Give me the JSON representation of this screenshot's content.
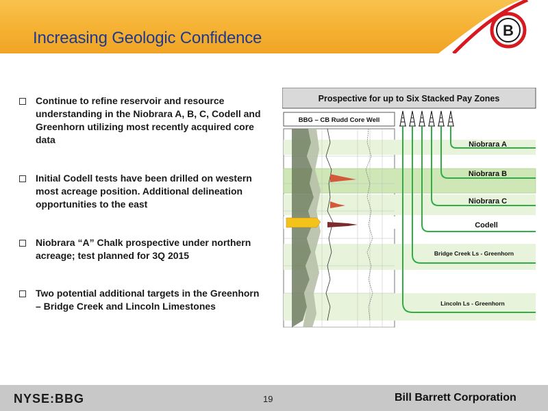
{
  "header": {
    "title": "Increasing Geologic Confidence",
    "logo_letter": "B"
  },
  "bullets": [
    "Continue to refine reservoir and resource understanding in the Niobrara A, B, C, Codell and Greenhorn utilizing most recently acquired core data",
    "Initial Codell tests have been drilled on western most acreage position.  Additional delineation opportunities to the east",
    "Niobrara “A” Chalk prospective under northern acreage; test planned for 3Q 2015",
    "Two potential additional targets in the Greenhorn – Bridge Creek and Lincoln Limestones"
  ],
  "figure": {
    "banner": "Prospective for up to Six Stacked Pay Zones",
    "well_label": "BBG – CB Rudd Core Well",
    "zones": [
      "Niobrara A",
      "Niobrara B",
      "Niobrara C",
      "Codell",
      "Bridge Creek Ls - Greenhorn",
      "Lincoln Ls - Greenhorn"
    ]
  },
  "footer": {
    "ticker": "NYSE:BBG",
    "page_number": "19",
    "company": "Bill Barrett Corporation"
  },
  "colors": {
    "header_orange": "#f5b133",
    "title_blue": "#1f3a8c",
    "zone_green_fill": "#d9ecc4",
    "zone_green_line": "#2fae43",
    "logo_red": "#d71920",
    "footer_gray": "#c8c8c8"
  }
}
